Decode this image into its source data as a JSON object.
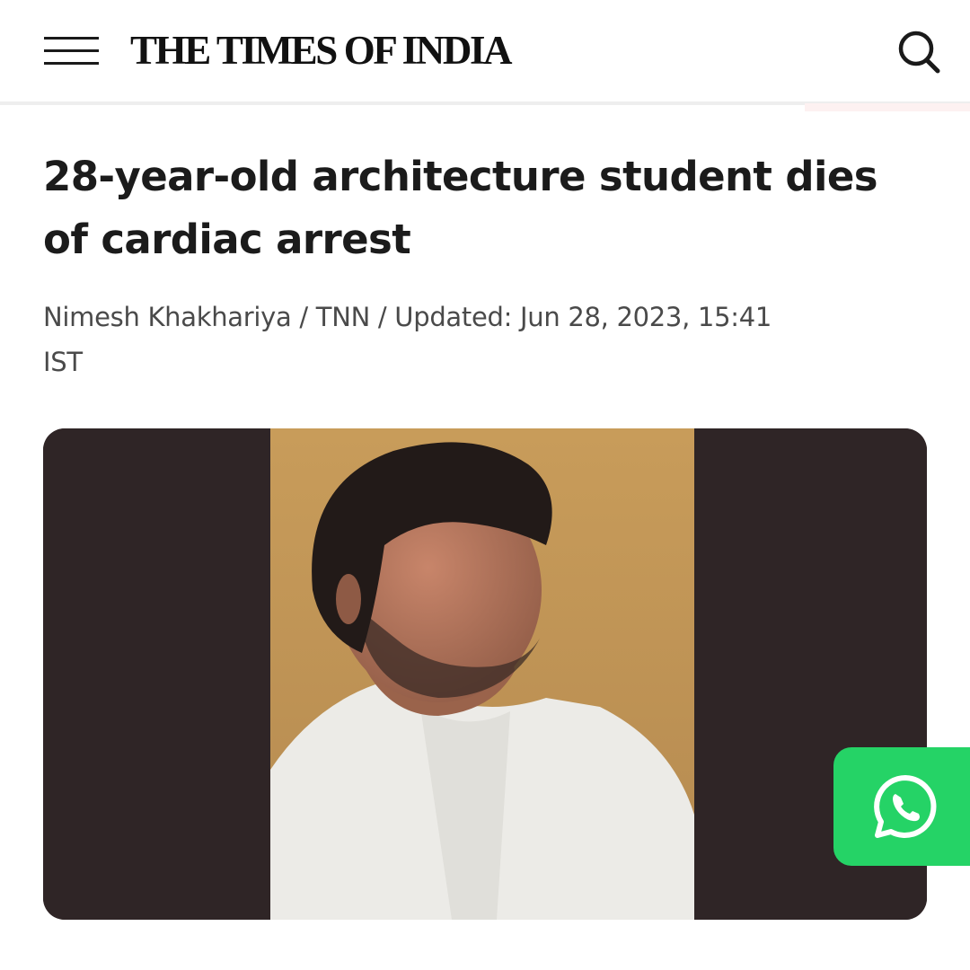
{
  "header": {
    "logo_text": "THE TIMES OF INDIA",
    "menu_icon": "hamburger-menu-icon",
    "search_icon": "search-icon"
  },
  "article": {
    "headline": "28-year-old architecture student dies of cardiac arrest",
    "byline": "Nimesh Khakhariya / TNN / Updated: Jun 28, 2023, 15:41 IST",
    "photo": "portrait of young man with dark hair and white shirt"
  },
  "share": {
    "whatsapp_icon": "whatsapp-icon"
  },
  "colors": {
    "whatsapp_green": "#25d366",
    "headline_text": "#1b1b1b",
    "byline_text": "#4a4a4a",
    "photo_background": "#2f2526",
    "photo_backdrop": "#c59a58"
  }
}
